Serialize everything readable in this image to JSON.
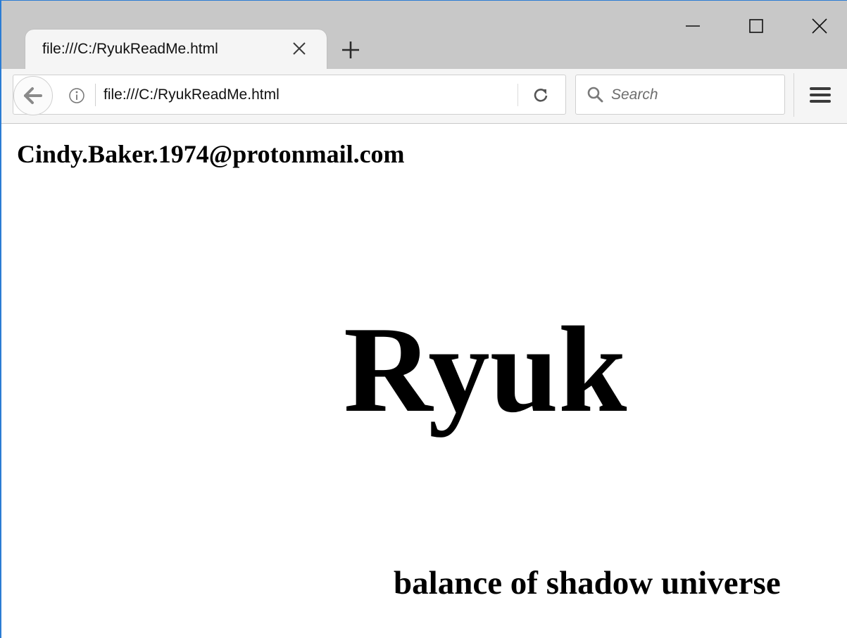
{
  "browser": {
    "tab": {
      "title": "file:///C:/RyukReadMe.html"
    },
    "address_bar": {
      "url": "file:///C:/RyukReadMe.html"
    },
    "search": {
      "placeholder": "Search"
    },
    "icons": {
      "back": "back-arrow-icon",
      "info": "info-icon",
      "reload": "reload-icon",
      "search": "search-icon",
      "menu": "hamburger-menu-icon",
      "tab_close": "close-icon",
      "new_tab": "plus-icon",
      "minimize": "minimize-icon",
      "maximize": "maximize-icon",
      "window_close": "close-icon"
    },
    "colors": {
      "tabstrip": "#c8c8c8",
      "toolbar": "#f5f5f5",
      "window_border": "#2b7cd3"
    }
  },
  "page": {
    "email": "Cindy.Baker.1974@protonmail.com",
    "heading": "Ryuk",
    "tagline": "balance of shadow universe"
  }
}
